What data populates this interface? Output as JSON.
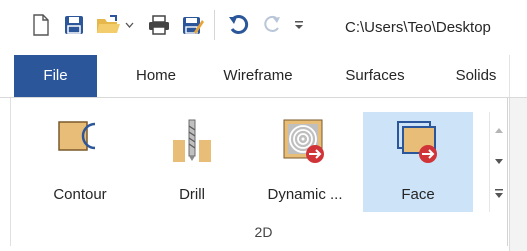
{
  "toolbar": {
    "path": "C:\\Users\\Teo\\Desktop",
    "icons": [
      "new-document-icon",
      "save-icon",
      "open-folder-icon",
      "print-icon",
      "save-as-icon",
      "undo-icon",
      "redo-icon",
      "customize-toolbar-icon"
    ]
  },
  "tabs": {
    "file": "File",
    "home": "Home",
    "wireframe": "Wireframe",
    "surfaces": "Surfaces",
    "solids": "Solids"
  },
  "group": {
    "label": "2D",
    "commands": [
      {
        "label": "Contour",
        "icon": "contour-icon",
        "selected": false
      },
      {
        "label": "Drill",
        "icon": "drill-icon",
        "selected": false
      },
      {
        "label": "Dynamic ...",
        "icon": "dynamic-icon",
        "selected": false
      },
      {
        "label": "Face",
        "icon": "face-icon",
        "selected": true
      }
    ]
  },
  "colors": {
    "file_tab": "#2b579a",
    "selected_command": "#cde3f7",
    "icon_accent": "#2b579a",
    "icon_orange": "#e8b868",
    "icon_red": "#d13438"
  }
}
